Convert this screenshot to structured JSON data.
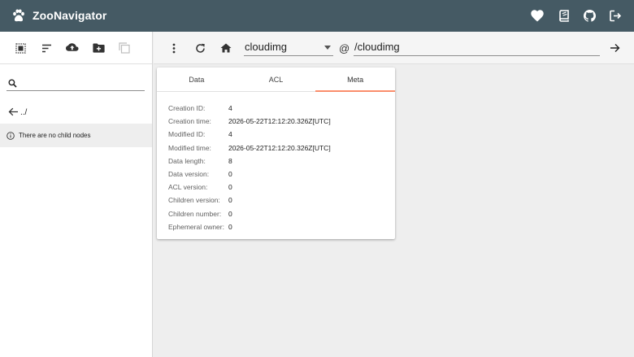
{
  "app": {
    "title": "ZooNavigator",
    "brand_color": "#455a64",
    "top_actions": [
      {
        "name": "favorite",
        "icon": "heart-icon"
      },
      {
        "name": "docs",
        "icon": "book-icon"
      },
      {
        "name": "github",
        "icon": "github-icon"
      },
      {
        "name": "logout",
        "icon": "logout-icon"
      }
    ]
  },
  "sidebar": {
    "toolbar": [
      {
        "name": "select-all",
        "icon": "select-all-icon"
      },
      {
        "name": "sort",
        "icon": "sort-icon"
      },
      {
        "name": "upload",
        "icon": "cloud-upload-icon"
      },
      {
        "name": "new-node",
        "icon": "create-folder-icon"
      },
      {
        "name": "duplicate",
        "icon": "copy-icon",
        "disabled": true
      }
    ],
    "search": {
      "placeholder": "",
      "value": ""
    },
    "parent_link": "../",
    "empty_message": "There are no child nodes"
  },
  "main": {
    "toolbar": [
      {
        "name": "more",
        "icon": "more-vert-icon"
      },
      {
        "name": "refresh",
        "icon": "refresh-icon"
      },
      {
        "name": "home",
        "icon": "home-icon"
      }
    ],
    "host": "cloudimg",
    "at": "@",
    "path": "/cloudimg"
  },
  "card": {
    "tabs": [
      {
        "label": "Data",
        "active": false
      },
      {
        "label": "ACL",
        "active": false
      },
      {
        "label": "Meta",
        "active": true
      }
    ],
    "active_tab_color": "#ff6e40",
    "meta": [
      {
        "key": "Creation ID:",
        "value": "4"
      },
      {
        "key": "Creation time:",
        "value": "2026-05-22T12:12:20.326Z[UTC]"
      },
      {
        "key": "Modified ID:",
        "value": "4"
      },
      {
        "key": "Modified time:",
        "value": "2026-05-22T12:12:20.326Z[UTC]"
      },
      {
        "key": "Data length:",
        "value": "8"
      },
      {
        "key": "Data version:",
        "value": "0"
      },
      {
        "key": "ACL version:",
        "value": "0"
      },
      {
        "key": "Children version:",
        "value": "0"
      },
      {
        "key": "Children number:",
        "value": "0"
      },
      {
        "key": "Ephemeral owner:",
        "value": "0"
      }
    ]
  }
}
